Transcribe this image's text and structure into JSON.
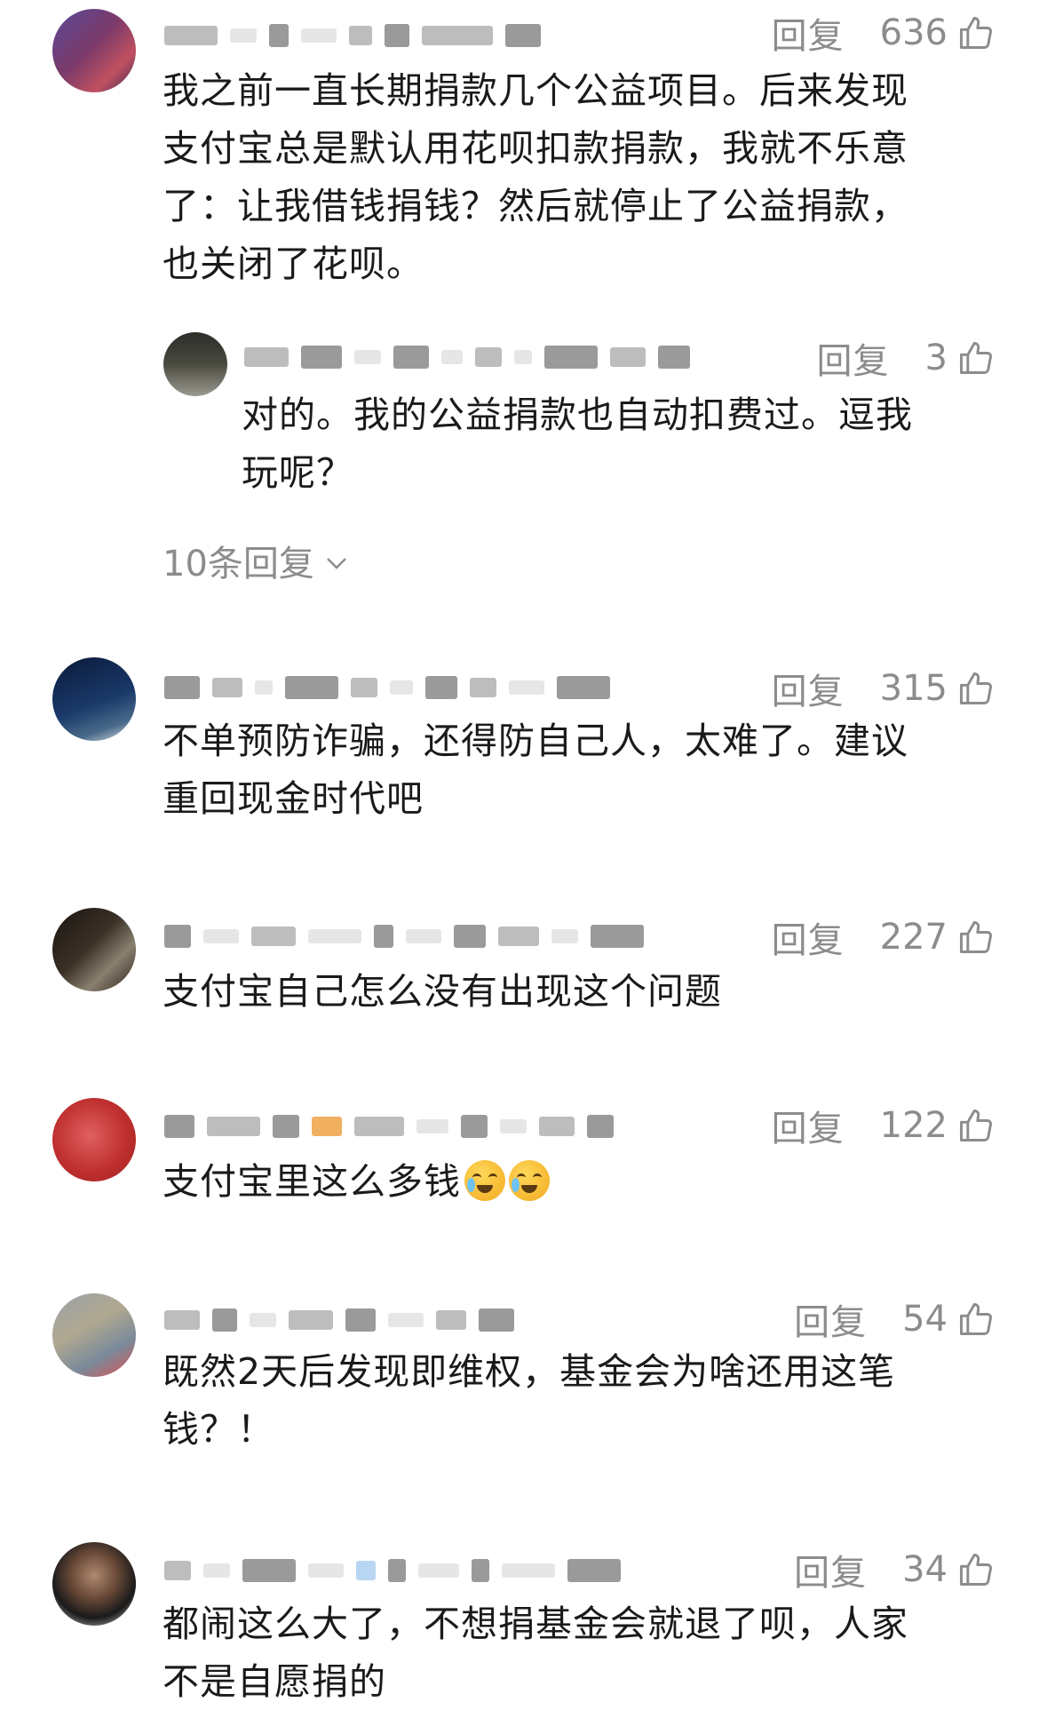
{
  "reply_label": "回复",
  "comments": [
    {
      "likes": "636",
      "text_lines": [
        "我之前一直长期捐款几个公益项目。后来发现",
        "支付宝总是默认用花呗扣款捐款，我就不乐意",
        "了：让我借钱捐钱？然后就停止了公益捐款，",
        "也关闭了花呗。"
      ],
      "sub_reply": {
        "likes": "3",
        "text_lines": [
          "对的。我的公益捐款也自动扣费过。逗我",
          "玩呢？"
        ]
      },
      "more_replies": "10条回复"
    },
    {
      "likes": "315",
      "text_lines": [
        "不单预防诈骗，还得防自己人，太难了。建议",
        "重回现金时代吧"
      ]
    },
    {
      "likes": "227",
      "text_lines": [
        "支付宝自己怎么没有出现这个问题"
      ]
    },
    {
      "likes": "122",
      "text_lines": [
        "支付宝里这么多钱"
      ],
      "emoji": [
        "crying-laughing-emoji",
        "crying-laughing-emoji"
      ]
    },
    {
      "likes": "54",
      "text_lines": [
        "既然2天后发现即维权，基金会为啥还用这笔",
        "钱？！"
      ]
    },
    {
      "likes": "34",
      "text_lines": [
        "都闹这么大了，不想捐基金会就退了呗，人家",
        "不是自愿捐的"
      ]
    }
  ],
  "colors": {
    "text": "#1a1a1a",
    "meta": "#8c8c8c",
    "background": "#ffffff"
  }
}
